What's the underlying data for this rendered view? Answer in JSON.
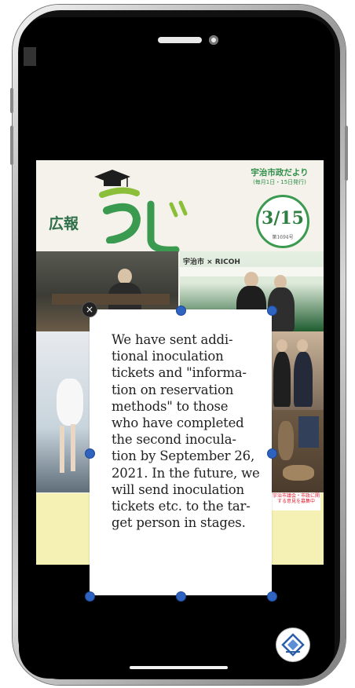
{
  "magazine": {
    "label": "広報",
    "publisher_line": "宇治市政だより",
    "publisher_sub": "(毎月1日・15日発行)",
    "date_number": "3/15",
    "issue_number": "第1694号",
    "banner_text": "宇治市 × RICOH",
    "notice_text": "宇治市議会・市政に関する意見を募集中"
  },
  "overlay": {
    "text": "We have sent addi-\ntional inoculation\ntickets and \"informa-\ntion on reservation\nmethods\" to those\nwho have completed\nthe second inocula-\ntion by September 26,\n2021. In the future, we\nwill send inoculation\ntickets etc. to the tar-\nget person in stages.",
    "close_symbol": "×"
  },
  "icons": {
    "close": "close-icon",
    "translate": "translate-icon",
    "graduation_cap": "graduation-cap-icon"
  },
  "colors": {
    "handle": "#2e63c0",
    "brand_green": "#3a9a4f"
  }
}
